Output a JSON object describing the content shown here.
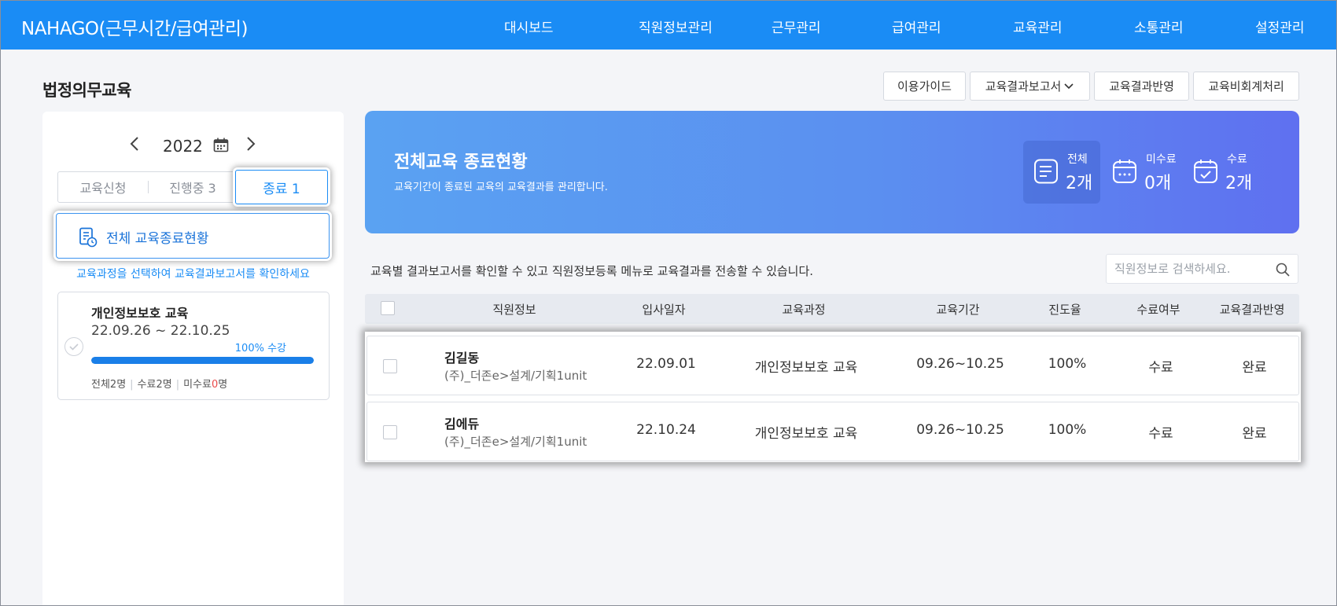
{
  "app": {
    "title": "NAHAGO(근무시간/급여관리)"
  },
  "nav": {
    "items": [
      "대시보드",
      "직원정보관리",
      "근무관리",
      "급여관리",
      "교육관리",
      "소통관리",
      "설정관리"
    ]
  },
  "page": {
    "title": "법정의무교육"
  },
  "toolbar": {
    "guide": "이용가이드",
    "report": "교육결과보고서",
    "apply": "교육결과반영",
    "accounting": "교육비회계처리"
  },
  "sidebar": {
    "year": "2022",
    "tabs": [
      "교육신청",
      "진행중 3",
      "종료 1"
    ],
    "active_tab": "종료 1",
    "all_button": "전체 교육종료현황",
    "hint": "교육과정을 선택하여 교육결과보고서를 확인하세요",
    "course": {
      "title": "개인정보보호 교육",
      "dates": "22.09.26 ~ 22.10.25",
      "percent_label": "100% 수강",
      "progress": 1.0,
      "stats": {
        "total": "전체2명",
        "done": "수료2명",
        "not_done_prefix": "미수료",
        "not_done_count": "0",
        "not_done_suffix": "명"
      }
    }
  },
  "banner": {
    "title": "전체교육 종료현황",
    "subtitle": "교육기간이 종료된 교육의 교육결과를 관리합니다.",
    "stats": [
      {
        "label": "전체",
        "value": "2개",
        "icon": "document-icon"
      },
      {
        "label": "미수료",
        "value": "0개",
        "icon": "calendar-pending-icon"
      },
      {
        "label": "수료",
        "value": "2개",
        "icon": "calendar-check-icon"
      }
    ]
  },
  "main": {
    "description": "교육별 결과보고서를 확인할 수 있고 직원정보등록 메뉴로 교육결과를 전송할 수 있습니다.",
    "search_placeholder": "직원정보로 검색하세요."
  },
  "table": {
    "headers": [
      "직원정보",
      "입사일자",
      "교육과정",
      "교육기간",
      "진도율",
      "수료여부",
      "교육결과반영"
    ],
    "rows": [
      {
        "name": "김길동",
        "dept": "(주)_더존e>설계/기획1unit",
        "join_date": "22.09.01",
        "course": "개인정보보호 교육",
        "period": "09.26~10.25",
        "progress": "100%",
        "status": "수료",
        "result": "완료"
      },
      {
        "name": "김에듀",
        "dept": "(주)_더존e>설계/기획1unit",
        "join_date": "22.10.24",
        "course": "개인정보보호 교육",
        "period": "09.26~10.25",
        "progress": "100%",
        "status": "수료",
        "result": "완료"
      }
    ]
  },
  "colors": {
    "primary": "#1a8cf5",
    "banner_start": "#5aa2f2",
    "banner_end": "#5f70f0",
    "alert": "#e94a4a"
  }
}
